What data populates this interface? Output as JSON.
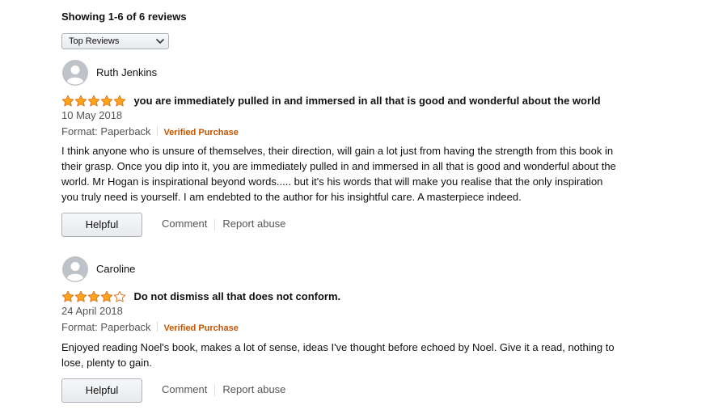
{
  "summary": "Showing 1-6 of 6 reviews",
  "sort": {
    "selected": "Top Reviews",
    "icon": "chevron-down-icon"
  },
  "colors": {
    "star": "#ffa41c",
    "star_outline": "#de7921",
    "verified": "#c45500",
    "avatar": "#bec3c9"
  },
  "reviews": [
    {
      "reviewer": "Ruth Jenkins",
      "rating": 5,
      "title": "you are immediately pulled in and immersed in all that is good and wonderful about the world",
      "date": "10 May 2018",
      "format": "Format: Paperback",
      "verified": "Verified Purchase",
      "body": "I think anyone who is unsure of themselves, their direction, will gain a lot just from having the strength from this book in their grasp. Once you dip into it, you are immediately pulled in and immersed in all that is good and wonderful about the world. Mr Hogan is inspirational beyond words..... but it's his words that will make you realise that the only inspiration you truly need is yourself. I am endebted to the author for his insightful care. A masterpiece indeed.",
      "helpful": "Helpful",
      "comment": "Comment",
      "report": "Report abuse"
    },
    {
      "reviewer": "Caroline",
      "rating": 4,
      "title": "Do not dismiss all that does not conform.",
      "date": "24 April 2018",
      "format": "Format: Paperback",
      "verified": "Verified Purchase",
      "body": "Enjoyed reading Noel's book, makes a lot of sense, ideas I've thought before echoed by Noel. Give it a read, nothing to lose, plenty to gain.",
      "helpful": "Helpful",
      "comment": "Comment",
      "report": "Report abuse"
    }
  ]
}
